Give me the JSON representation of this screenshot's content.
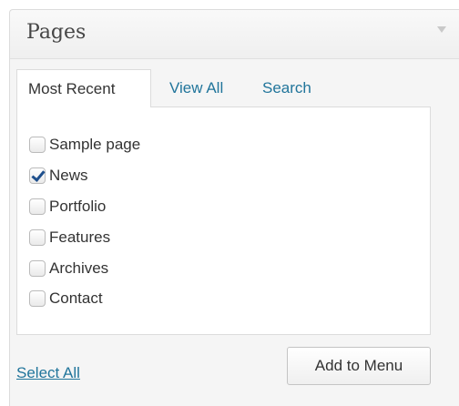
{
  "panel": {
    "title": "Pages",
    "toggle_icon": "triangle-down-icon"
  },
  "tabs": [
    {
      "label": "Most Recent",
      "active": true
    },
    {
      "label": "View All",
      "active": false
    },
    {
      "label": "Search",
      "active": false
    }
  ],
  "items": [
    {
      "label": "Sample page",
      "checked": false
    },
    {
      "label": "News",
      "checked": true
    },
    {
      "label": "Portfolio",
      "checked": false
    },
    {
      "label": "Features",
      "checked": false
    },
    {
      "label": "Archives",
      "checked": false
    },
    {
      "label": "Contact",
      "checked": false
    }
  ],
  "footer": {
    "select_all_label": "Select All",
    "add_button_label": "Add to Menu"
  },
  "colors": {
    "link": "#21759b",
    "check": "#1e4f8c"
  }
}
